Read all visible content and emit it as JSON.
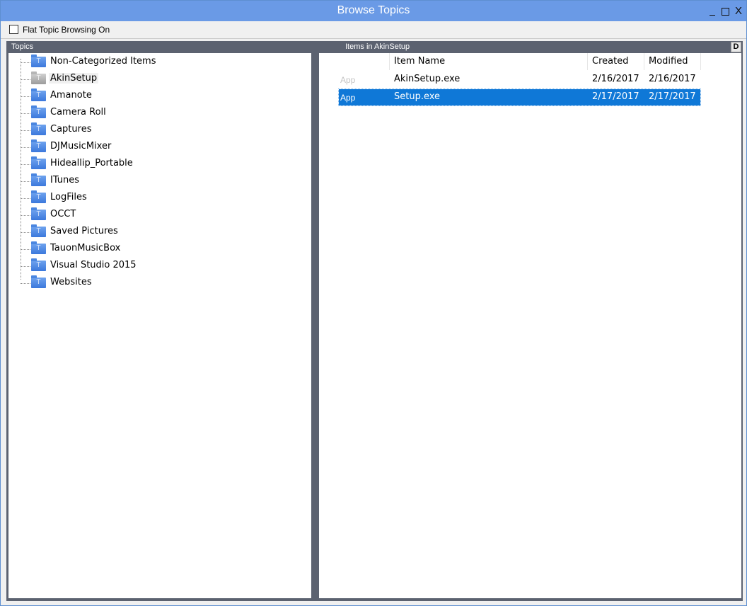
{
  "window": {
    "title": "Browse Topics",
    "minimize_glyph": "_",
    "close_glyph": "X"
  },
  "toolbar": {
    "flat_browsing_label": "Flat Topic Browsing On",
    "flat_browsing_checked": false
  },
  "topics_pane": {
    "header": "Topics",
    "selected": "AkinSetup",
    "items": [
      {
        "label": "Non-Categorized Items",
        "icon": "folder-icon"
      },
      {
        "label": "AkinSetup",
        "icon": "folder-icon-grey"
      },
      {
        "label": "Amanote",
        "icon": "folder-icon"
      },
      {
        "label": "Camera Roll",
        "icon": "folder-icon"
      },
      {
        "label": "Captures",
        "icon": "folder-icon"
      },
      {
        "label": "DJMusicMixer",
        "icon": "folder-icon"
      },
      {
        "label": "Hideallip_Portable",
        "icon": "folder-icon"
      },
      {
        "label": "ITunes",
        "icon": "folder-icon"
      },
      {
        "label": "LogFiles",
        "icon": "folder-icon"
      },
      {
        "label": "OCCT",
        "icon": "folder-icon"
      },
      {
        "label": "Saved Pictures",
        "icon": "folder-icon"
      },
      {
        "label": "TauonMusicBox",
        "icon": "folder-icon"
      },
      {
        "label": "Visual Studio 2015",
        "icon": "folder-icon"
      },
      {
        "label": "Websites",
        "icon": "folder-icon"
      }
    ],
    "folder_glyph": "T"
  },
  "items_pane": {
    "header": "Items in AkinSetup",
    "d_button_label": "D",
    "columns": {
      "name": "Item Name",
      "created": "Created",
      "modified": "Modified"
    },
    "rows": [
      {
        "type": "App",
        "name": "AkinSetup.exe",
        "created": "2/16/2017",
        "modified": "2/16/2017",
        "selected": false
      },
      {
        "type": "App",
        "name": "Setup.exe",
        "created": "2/17/2017",
        "modified": "2/17/2017",
        "selected": true
      }
    ]
  },
  "colors": {
    "titlebar": "#6a9ae6",
    "frame": "#5c6270",
    "selection": "#0f78d7",
    "folder": "#3b78dc"
  }
}
